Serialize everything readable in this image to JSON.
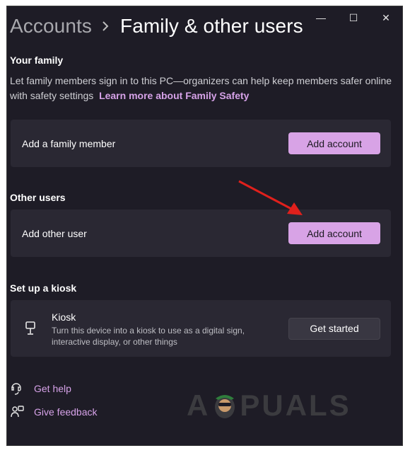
{
  "window": {
    "controls": {
      "minimize": "—",
      "maximize": "☐",
      "close": "✕"
    }
  },
  "breadcrumb": {
    "parent": "Accounts",
    "current": "Family & other users"
  },
  "your_family": {
    "title": "Your family",
    "description": "Let family members sign in to this PC—organizers can help keep members safer online with safety settings",
    "link": "Learn more about Family Safety",
    "card_label": "Add a family member",
    "button": "Add account"
  },
  "other_users": {
    "title": "Other users",
    "card_label": "Add other user",
    "button": "Add account"
  },
  "kiosk": {
    "title": "Set up a kiosk",
    "card_title": "Kiosk",
    "card_description": "Turn this device into a kiosk to use as a digital sign, interactive display, or other things",
    "button": "Get started"
  },
  "help": {
    "get_help": "Get help",
    "give_feedback": "Give feedback"
  },
  "watermark": {
    "text_left": "A",
    "text_right": "PUALS"
  },
  "colors": {
    "background": "#1e1c26",
    "card": "#2a2833",
    "accent": "#d8a3e6",
    "link": "#d6a2e8",
    "annotation_arrow": "#e0201c"
  }
}
